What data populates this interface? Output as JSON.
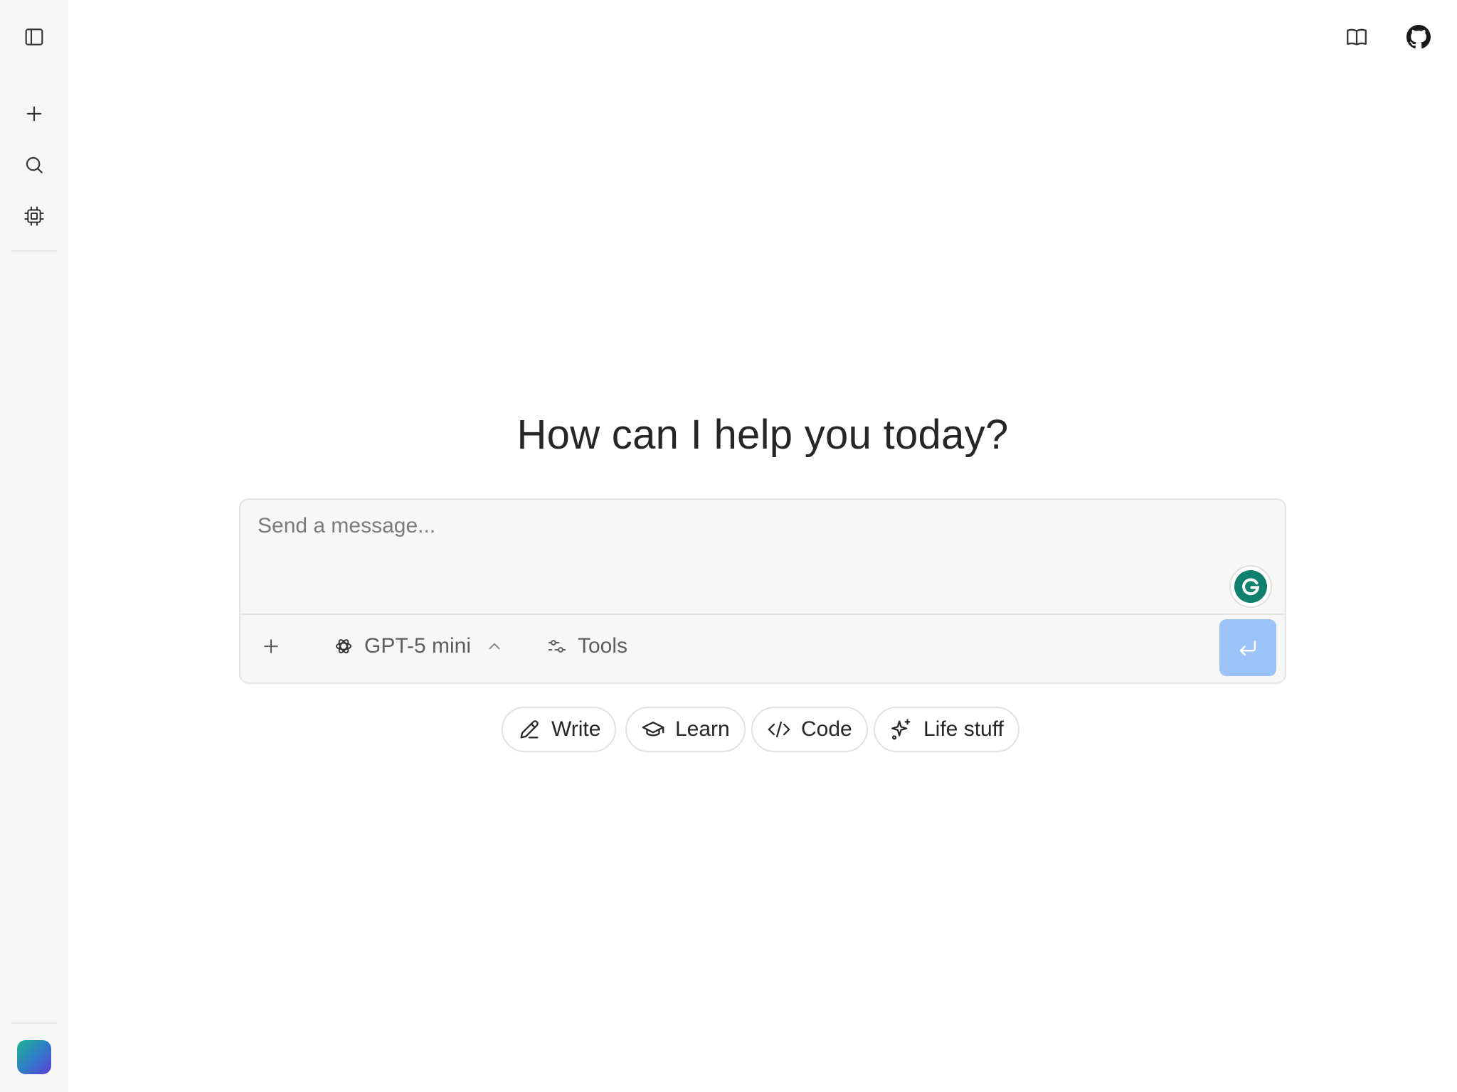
{
  "sidebar": {
    "icons": [
      "sidebar-toggle-icon",
      "plus-icon",
      "search-icon",
      "cpu-icon"
    ]
  },
  "header": {
    "icons": [
      "book-open-icon",
      "github-icon"
    ]
  },
  "main": {
    "greeting": "How can I help you today?"
  },
  "composer": {
    "placeholder": "Send a message...",
    "model_label": "GPT-5 mini",
    "tools_label": "Tools"
  },
  "suggestions": [
    {
      "label": "Write",
      "icon": "pencil-icon"
    },
    {
      "label": "Learn",
      "icon": "graduation-cap-icon"
    },
    {
      "label": "Code",
      "icon": "code-icon"
    },
    {
      "label": "Life stuff",
      "icon": "sparkles-icon"
    }
  ],
  "colors": {
    "sidebar_bg": "#f7f7f7",
    "composer_bg": "#f7f7f7",
    "send_button": "#9cc3f7",
    "grammarly": "#0f7f6e"
  }
}
